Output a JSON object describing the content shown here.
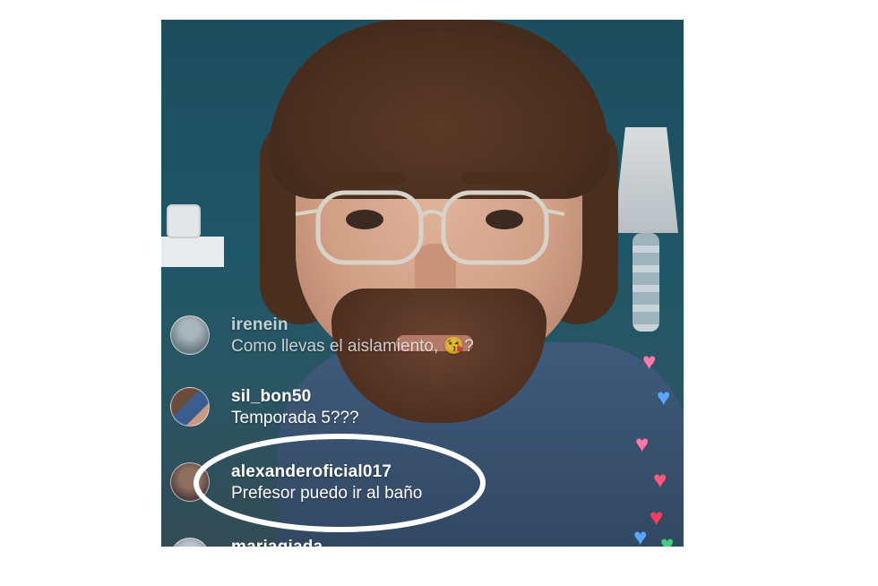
{
  "comments": [
    {
      "username": "irenein",
      "message": "Como llevas el aislamiento, 😘?"
    },
    {
      "username": "sil_bon50",
      "message": "Temporada 5???"
    },
    {
      "username": "alexanderoficial017",
      "message": "Prefesor puedo ir al baño"
    },
    {
      "username": "mariagiada",
      "message": ""
    }
  ],
  "icons": {
    "heart": "heart-icon",
    "emoji": "kiss-emoji"
  },
  "colors": {
    "highlight_ring": "#ffffff",
    "heart_pink": "#ff7aa8",
    "heart_blue": "#58a6ff",
    "heart_green": "#44d07a"
  }
}
